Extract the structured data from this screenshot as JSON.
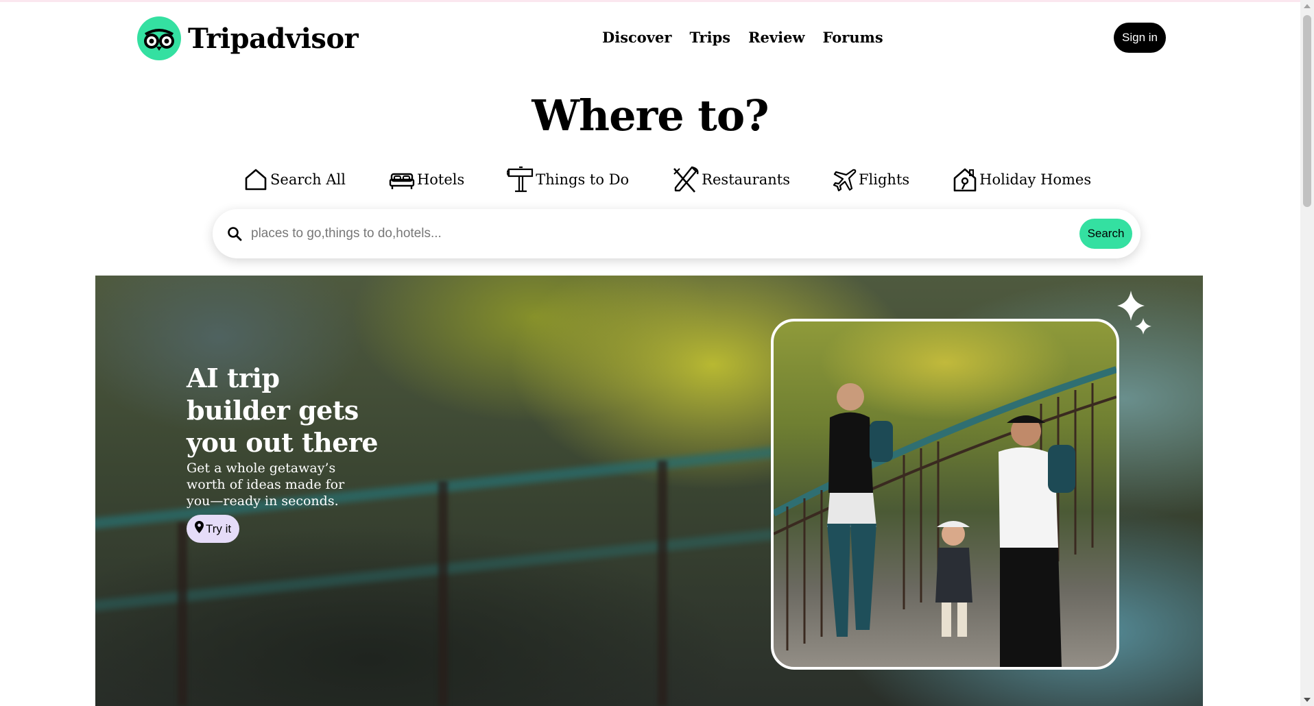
{
  "brand": {
    "name": "Tripadvisor",
    "accent": "#34e0a1"
  },
  "nav": [
    "Discover",
    "Trips",
    "Review",
    "Forums"
  ],
  "signin_label": "Sign in",
  "headline": "Where to?",
  "categories": [
    {
      "label": "Search All",
      "icon": "house-icon"
    },
    {
      "label": "Hotels",
      "icon": "bed-icon"
    },
    {
      "label": "Things to Do",
      "icon": "signpost-icon"
    },
    {
      "label": "Restaurants",
      "icon": "fork-knife-icon"
    },
    {
      "label": "Flights",
      "icon": "plane-icon"
    },
    {
      "label": "Holiday Homes",
      "icon": "holiday-home-icon"
    }
  ],
  "search": {
    "placeholder": "places to go,things to do,hotels...",
    "button_label": "Search"
  },
  "hero": {
    "title": "AI trip builder gets you out there",
    "subtitle": "Get a whole getaway’s worth of ideas made for you—ready in seconds.",
    "button_label": "Try it",
    "button_color": "#e5dcf8",
    "image": "family-hiking-photo"
  }
}
